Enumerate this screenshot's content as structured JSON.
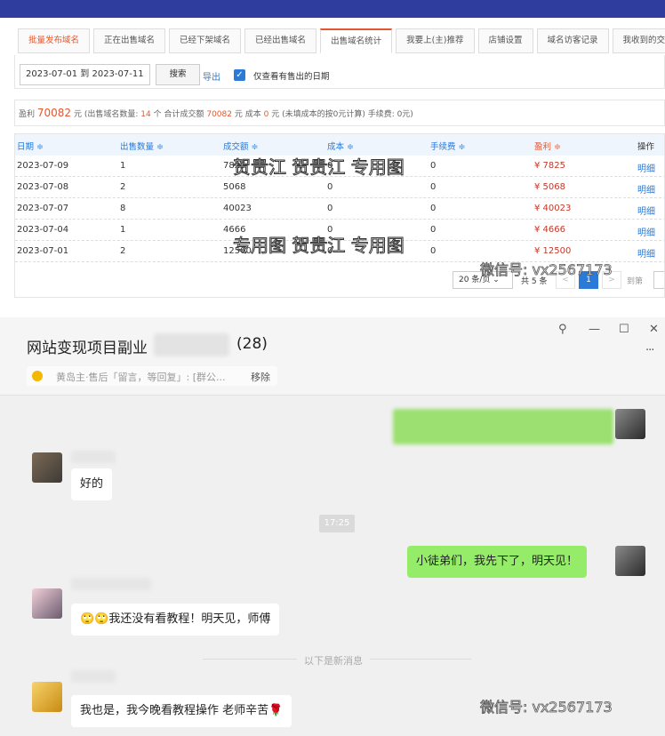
{
  "tabs": [
    "批量发布域名",
    "正在出售域名",
    "已经下架域名",
    "已经出售域名",
    "出售域名统计",
    "我要上(主)推荐",
    "店铺设置",
    "域名访客记录",
    "我收到的交易"
  ],
  "filter": {
    "date_range": "2023-07-01 到 2023-07-11",
    "search_label": "搜索",
    "export_label": "导出",
    "checkbox_label": "仅查看有售出的日期"
  },
  "summary": {
    "profit_label": "盈利",
    "profit_value": "70082",
    "unit": "元",
    "detail_a": "(出售域名数量:",
    "count": "14",
    "detail_b": "个 合计成交额",
    "total": "70082",
    "detail_c": "元 成本",
    "cost": "0",
    "detail_d": "元 (未填成本的按0元计算)  手续费: 0元)"
  },
  "table": {
    "headers": [
      "日期 ≑",
      "出售数量 ≑",
      "成交额 ≑",
      "成本 ≑",
      "手续费 ≑",
      "盈利 ≑",
      "操作"
    ],
    "rows": [
      [
        "2023-07-09",
        "1",
        "7825",
        "0",
        "0",
        "¥ 7825",
        "明细"
      ],
      [
        "2023-07-08",
        "2",
        "5068",
        "0",
        "0",
        "¥ 5068",
        "明细"
      ],
      [
        "2023-07-07",
        "8",
        "40023",
        "0",
        "0",
        "¥ 40023",
        "明细"
      ],
      [
        "2023-07-04",
        "1",
        "4666",
        "0",
        "0",
        "¥ 4666",
        "明细"
      ],
      [
        "2023-07-01",
        "2",
        "12500",
        "0",
        "0",
        "¥ 12500",
        "明细"
      ]
    ]
  },
  "pager": {
    "size": "20 条/页 ⌄",
    "total": "共 5 条",
    "prev": "<",
    "current": "1",
    "next": ">",
    "goto": "到第"
  },
  "watermarks": {
    "w1": "贺贵江  贺贵江  专用图",
    "w2": "专用图  贺贵江  专用图",
    "wechat": "微信号: vx2567173"
  },
  "chat": {
    "title": "网站变现项目副业",
    "count": "(28)",
    "window_buttons": {
      "pin": "⚲",
      "min": "—",
      "max": "☐",
      "close": "✕",
      "more": "···"
    },
    "pinned_text": "黄岛主·售后「留言，等回复」: [群公...",
    "pinned_remove": "移除",
    "msg1": "好的",
    "time": "17:25",
    "msg2": "小徒弟们，我先下了，明天见！",
    "msg3": "🙄🙄我还没有看教程！明天见，师傅",
    "new_msgs": "以下是新消息",
    "msg4": "我也是，我今晚看教程操作 老师辛苦🌹"
  },
  "colors": {
    "accent": "#e4572e",
    "link": "#2b7ad8",
    "bubble_me": "#95ec69"
  }
}
